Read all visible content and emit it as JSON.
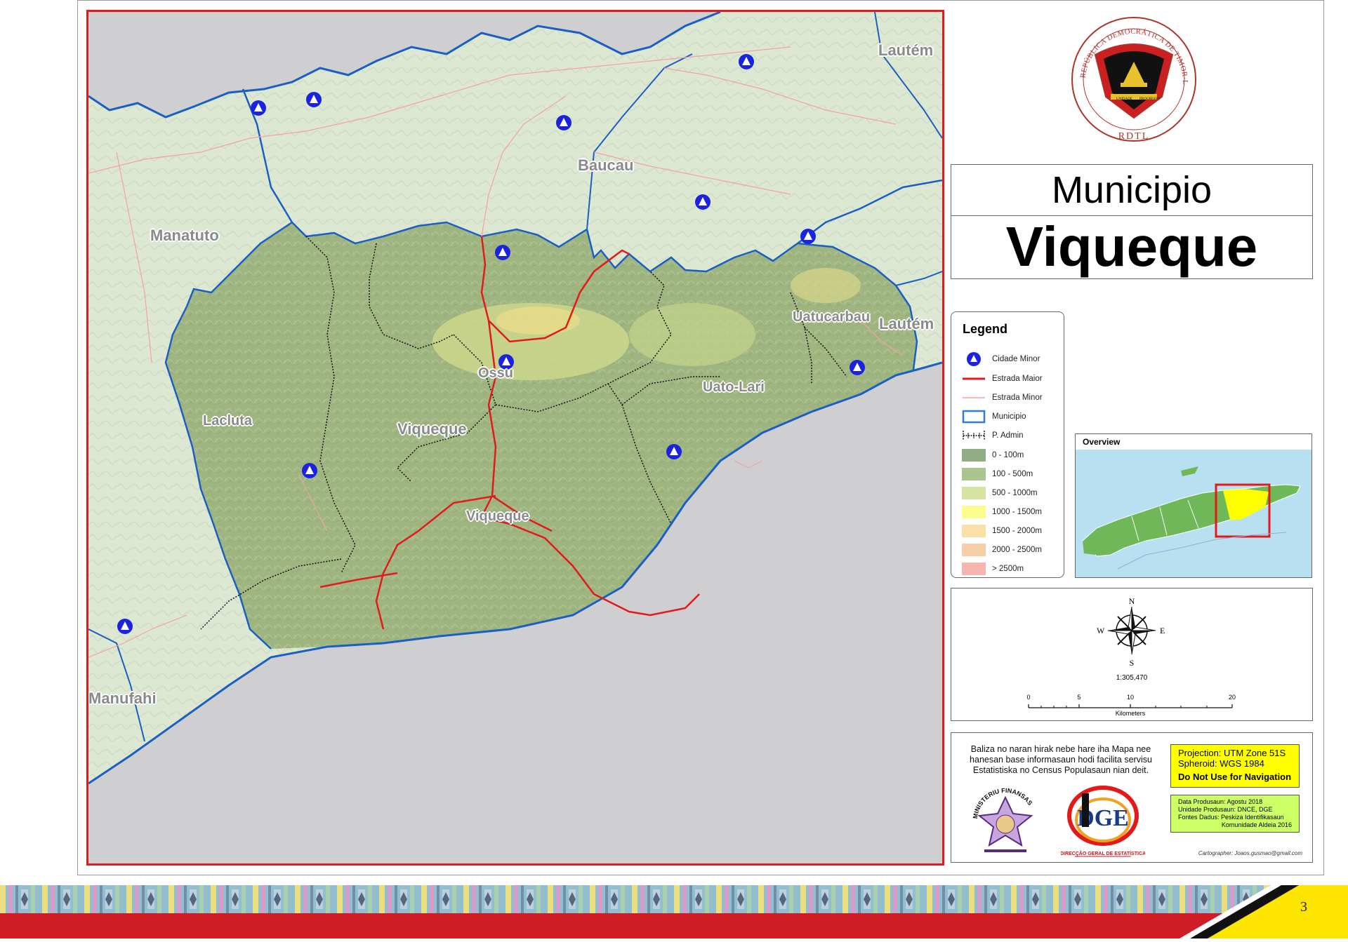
{
  "map": {
    "labels": {
      "manatuto": "Manatuto",
      "baucau": "Baucau",
      "lautem_top": "Lautém",
      "lautem_mid": "Lautém",
      "uatucarbau": "Uatucarbau",
      "uato_lari": "Uato-Lari",
      "ossu": "Ossu",
      "lacluta": "Lacluta",
      "viqueque_admin": "Viqueque",
      "viqueque_town": "Viqueque",
      "manufahi": "Manufahi"
    }
  },
  "seal": {
    "ring_text": "REPÚBLICA DEMOCRÁTICA DE TIMOR-LESTE",
    "bottom_text": "RDTL",
    "ribbon_left": "UNIDADE",
    "ribbon_mid": "ACÇÃO",
    "ribbon_right": "PROGRESSO"
  },
  "title": {
    "subtitle": "Municipio",
    "name": "Viqueque"
  },
  "legend": {
    "heading": "Legend",
    "items": [
      {
        "label": "Cidade Minor",
        "kind": "point"
      },
      {
        "label": "Estrada Maior",
        "kind": "line",
        "color": "#e41a1a"
      },
      {
        "label": "Estrada Minor",
        "kind": "line",
        "color": "#f5a0a8"
      },
      {
        "label": "Municipio",
        "kind": "outline",
        "color": "#2a7fd8"
      },
      {
        "label": "P. Admin",
        "kind": "hatch",
        "color": "#111111"
      },
      {
        "label": "0 - 100m",
        "kind": "fill",
        "color": "#8fae86"
      },
      {
        "label": "100 - 500m",
        "kind": "fill",
        "color": "#a9c48c"
      },
      {
        "label": "500 - 1000m",
        "kind": "fill",
        "color": "#d6e4a3"
      },
      {
        "label": "1000 - 1500m",
        "kind": "fill",
        "color": "#fbfb8e"
      },
      {
        "label": "1500 - 2000m",
        "kind": "fill",
        "color": "#f9e0a6"
      },
      {
        "label": "2000 - 2500m",
        "kind": "fill",
        "color": "#f7cfa6"
      },
      {
        "label": "> 2500m",
        "kind": "fill",
        "color": "#f7b5b0"
      }
    ]
  },
  "overview": {
    "title": "Overview"
  },
  "compass": {
    "n": "N",
    "s": "S",
    "e": "E",
    "w": "W"
  },
  "scale": {
    "ratio": "1:305,470",
    "ticks": [
      "0",
      "5",
      "10",
      "20"
    ],
    "unit": "Kilometers"
  },
  "info": {
    "disclaimer": "Baliza no naran hirak nebe hare iha Mapa nee hanesan base informasaun hodi facilita servisu Estatistiska no Census Populasaun nian deit.",
    "projection": "Projection: UTM Zone 51S",
    "spheroid": "Spheroid: WGS 1984",
    "warning": "Do Not Use for Navigation",
    "meta": [
      "Data Produsaun: Agostu 2018",
      "Unidade Produsaun: DNCE, DGE",
      "Fontes Dadus: Peskiza Identifikasaun",
      "Komunidade Aldeia 2016"
    ],
    "cartographer": "Cartographer: Joaos.gusmao@gmail.com",
    "logo1_text": "MINISTERIU FINANSAS",
    "logo2_text": "DIRECÇÃO GERAL DE ESTATÍSTICA",
    "logo2_mark": "DGE"
  },
  "footer": {
    "page_number": "3"
  },
  "colors": {
    "frame": "#e01b1b",
    "sea": "#cfcfd1",
    "land_other": "#dde8d3",
    "viqueque_fill": "#9fb57f",
    "coast": "#1a5fc4",
    "major_road": "#e41a1a",
    "minor_road": "#f5a0a8",
    "town_marker": "#1a24e0"
  }
}
